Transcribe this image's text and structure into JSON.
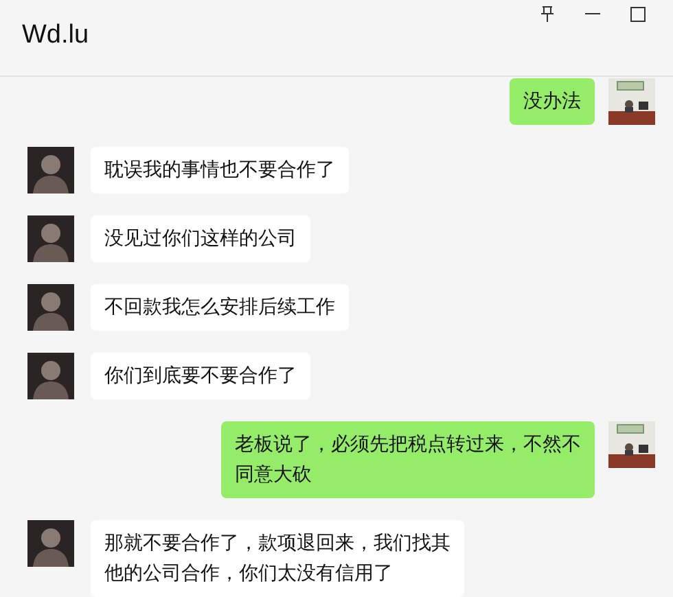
{
  "window": {
    "title": "Wd.lu"
  },
  "messages": [
    {
      "kind": "sent",
      "text": "没办法"
    },
    {
      "kind": "received",
      "text": "耽误我的事情也不要合作了"
    },
    {
      "kind": "received",
      "text": "没见过你们这样的公司"
    },
    {
      "kind": "received",
      "text": "不回款我怎么安排后续工作"
    },
    {
      "kind": "received",
      "text": "你们到底要不要合作了"
    },
    {
      "kind": "sent",
      "text": "老板说了，必须先把税点转过来，不然不同意大砍"
    },
    {
      "kind": "received",
      "text": "那就不要合作了，款项退回来，我们找其他的公司合作，你们太没有信用了"
    }
  ]
}
